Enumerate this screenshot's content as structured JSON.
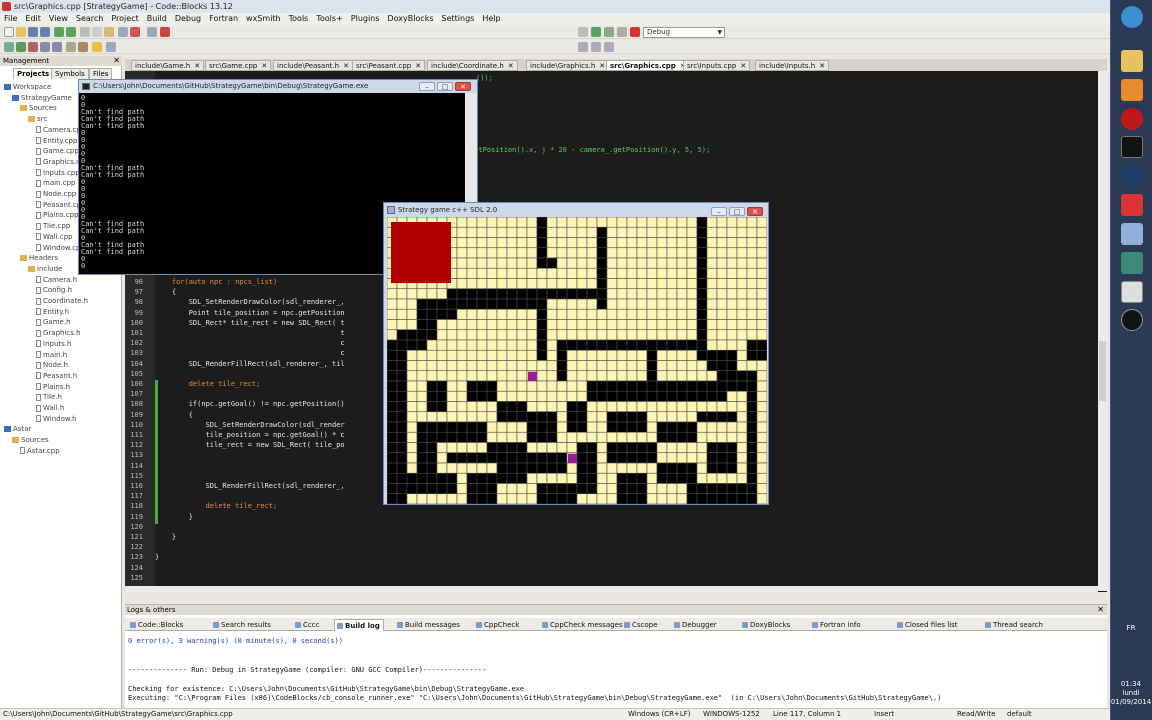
{
  "window_title": "src\\Graphics.cpp [StrategyGame] - Code::Blocks 13.12",
  "menu": [
    "File",
    "Edit",
    "View",
    "Search",
    "Project",
    "Build",
    "Debug",
    "Fortran",
    "wxSmith",
    "Tools",
    "Tools+",
    "Plugins",
    "DoxyBlocks",
    "Settings",
    "Help"
  ],
  "build_target": "Debug",
  "management": {
    "title": "Management",
    "tabs": [
      "Projects",
      "Symbols",
      "Files"
    ],
    "tree": [
      {
        "label": "Workspace",
        "kind": "proj",
        "indent": 0
      },
      {
        "label": "StrategyGame",
        "kind": "proj",
        "indent": 1
      },
      {
        "label": "Sources",
        "kind": "folder",
        "indent": 2
      },
      {
        "label": "src",
        "kind": "folder",
        "indent": 3
      },
      {
        "label": "Camera.cpp",
        "kind": "file",
        "indent": 4
      },
      {
        "label": "Entity.cpp",
        "kind": "file",
        "indent": 4
      },
      {
        "label": "Game.cpp",
        "kind": "file",
        "indent": 4
      },
      {
        "label": "Graphics.cpp",
        "kind": "file",
        "indent": 4
      },
      {
        "label": "Inputs.cpp",
        "kind": "file",
        "indent": 4
      },
      {
        "label": "main.cpp",
        "kind": "file",
        "indent": 4
      },
      {
        "label": "Node.cpp",
        "kind": "file",
        "indent": 4
      },
      {
        "label": "Peasant.cpp",
        "kind": "file",
        "indent": 4
      },
      {
        "label": "Plains.cpp",
        "kind": "file",
        "indent": 4
      },
      {
        "label": "Tile.cpp",
        "kind": "file",
        "indent": 4
      },
      {
        "label": "Wall.cpp",
        "kind": "file",
        "indent": 4
      },
      {
        "label": "Window.cpp",
        "kind": "file",
        "indent": 4
      },
      {
        "label": "Headers",
        "kind": "folder",
        "indent": 2
      },
      {
        "label": "include",
        "kind": "folder",
        "indent": 3
      },
      {
        "label": "Camera.h",
        "kind": "file",
        "indent": 4
      },
      {
        "label": "Config.h",
        "kind": "file",
        "indent": 4
      },
      {
        "label": "Coordinate.h",
        "kind": "file",
        "indent": 4
      },
      {
        "label": "Entity.h",
        "kind": "file",
        "indent": 4
      },
      {
        "label": "Game.h",
        "kind": "file",
        "indent": 4
      },
      {
        "label": "Graphics.h",
        "kind": "file",
        "indent": 4
      },
      {
        "label": "Inputs.h",
        "kind": "file",
        "indent": 4
      },
      {
        "label": "main.h",
        "kind": "file",
        "indent": 4
      },
      {
        "label": "Node.h",
        "kind": "file",
        "indent": 4
      },
      {
        "label": "Peasant.h",
        "kind": "file",
        "indent": 4
      },
      {
        "label": "Plains.h",
        "kind": "file",
        "indent": 4
      },
      {
        "label": "Tile.h",
        "kind": "file",
        "indent": 4
      },
      {
        "label": "Wall.h",
        "kind": "file",
        "indent": 4
      },
      {
        "label": "Window.h",
        "kind": "file",
        "indent": 4
      },
      {
        "label": "Astar",
        "kind": "proj",
        "indent": 0
      },
      {
        "label": "Sources",
        "kind": "folder",
        "indent": 1
      },
      {
        "label": "Astar.cpp",
        "kind": "file",
        "indent": 2
      }
    ]
  },
  "editor_tabs": [
    {
      "label": "include\\Game.h",
      "active": false
    },
    {
      "label": "src\\Game.cpp",
      "active": false
    },
    {
      "label": "include\\Peasant.h",
      "active": false
    },
    {
      "label": "src\\Peasant.cpp",
      "active": false
    },
    {
      "label": "include\\Coordinate.h",
      "active": false
    },
    {
      "label": "include\\Graphics.h",
      "active": false
    },
    {
      "label": "src\\Graphics.cpp",
      "active": true
    },
    {
      "label": "src\\Inputs.cpp",
      "active": false
    },
    {
      "label": "include\\Inputs.h",
      "active": false
    }
  ],
  "code_top_fragments": [
    "());",
    "getPosition().x, j * 20 - camera_.getPosition().y, 5, 5);"
  ],
  "code_lines": [
    {
      "n": "96",
      "t": "    for(auto npc : npcs_list)",
      "kw": true
    },
    {
      "n": "97",
      "t": "    {"
    },
    {
      "n": "98",
      "t": "        SDL_SetRenderDrawColor(sdl_renderer_,"
    },
    {
      "n": "99",
      "t": "        Point tile_position = npc.getPosition"
    },
    {
      "n": "100",
      "t": "        SDL_Rect* tile_rect = new SDL_Rect( t"
    },
    {
      "n": "101",
      "t": "                                            t"
    },
    {
      "n": "102",
      "t": "                                            c"
    },
    {
      "n": "103",
      "t": "                                            c"
    },
    {
      "n": "104",
      "t": "        SDL_RenderFillRect(sdl_renderer_, til"
    },
    {
      "n": "105",
      "t": ""
    },
    {
      "n": "106",
      "t": "        delete tile_rect;",
      "kw": true
    },
    {
      "n": "107",
      "t": ""
    },
    {
      "n": "108",
      "t": "        if(npc.getGoal() != npc.getPosition()"
    },
    {
      "n": "109",
      "t": "        {"
    },
    {
      "n": "110",
      "t": "            SDL_SetRenderDrawColor(sdl_render"
    },
    {
      "n": "111",
      "t": "            tile_position = npc.getGoal() * c"
    },
    {
      "n": "112",
      "t": "            tile_rect = new SDL_Rect( tile_po"
    },
    {
      "n": "113",
      "t": ""
    },
    {
      "n": "114",
      "t": ""
    },
    {
      "n": "115",
      "t": ""
    },
    {
      "n": "116",
      "t": "            SDL_RenderFillRect(sdl_renderer_,"
    },
    {
      "n": "117",
      "t": ""
    },
    {
      "n": "118",
      "t": "            delete tile_rect;",
      "kw": true
    },
    {
      "n": "119",
      "t": "        }"
    },
    {
      "n": "120",
      "t": ""
    },
    {
      "n": "121",
      "t": "    }"
    },
    {
      "n": "122",
      "t": ""
    },
    {
      "n": "123",
      "t": "}"
    },
    {
      "n": "124",
      "t": ""
    },
    {
      "n": "125",
      "t": ""
    }
  ],
  "console": {
    "title": "C:\\Users\\John\\Documents\\GitHub\\StrategyGame\\bin\\Debug\\StrategyGame.exe",
    "lines": [
      "0",
      "0",
      "Can't find path",
      "Can't find path",
      "Can't find path",
      "0",
      "0",
      "0",
      "0",
      "0",
      "Can't find path",
      "Can't find path",
      "0",
      "0",
      "0",
      "0",
      "0",
      "0",
      "Can't find path",
      "Can't find path",
      "0",
      "Can't find path",
      "Can't find path",
      "0",
      "0"
    ]
  },
  "sdl_window": {
    "title": "Strategy game c++ SDL 2.0",
    "colors": {
      "floor": "#fff5b5",
      "wall": "#000000",
      "base": "#b30000",
      "unit": "#9c1a9c",
      "grid": "#4a4a4a"
    }
  },
  "logs": {
    "title": "Logs & others",
    "tabs": [
      {
        "label": "Code::Blocks",
        "active": false
      },
      {
        "label": "Search results",
        "active": false
      },
      {
        "label": "Cccc",
        "active": false
      },
      {
        "label": "Build log",
        "active": true
      },
      {
        "label": "Build messages",
        "active": false
      },
      {
        "label": "CppCheck",
        "active": false
      },
      {
        "label": "CppCheck messages",
        "active": false
      },
      {
        "label": "Cscope",
        "active": false
      },
      {
        "label": "Debugger",
        "active": false
      },
      {
        "label": "DoxyBlocks",
        "active": false
      },
      {
        "label": "Fortran info",
        "active": false
      },
      {
        "label": "Closed files list",
        "active": false
      },
      {
        "label": "Thread search",
        "active": false
      }
    ],
    "lines": [
      "0 error(s), 3 warning(s) (0 minute(s), 0 second(s))",
      "",
      "",
      "-------------- Run: Debug in StrategyGame (compiler: GNU GCC Compiler)---------------",
      "",
      "Checking for existence: C:\\Users\\John\\Documents\\GitHub\\StrategyGame\\bin\\Debug\\StrategyGame.exe",
      "Executing: \"C:\\Program Files (x86)\\CodeBlocks/cb_console_runner.exe\" \"C:\\Users\\John\\Documents\\GitHub\\StrategyGame\\bin\\Debug\\StrategyGame.exe\"  (in C:\\Users\\John\\Documents\\GitHub\\StrategyGame\\.)"
    ]
  },
  "status": {
    "path": "C:\\Users\\John\\Documents\\GitHub\\StrategyGame\\src\\Graphics.cpp",
    "eol": "Windows (CR+LF)",
    "encoding": "WINDOWS-1252",
    "position": "Line 117, Column 1",
    "mode": "Insert",
    "access": "Read/Write",
    "lang": "default"
  },
  "taskbar": {
    "lang": "FR",
    "time": "01:34",
    "day": "lundi",
    "date": "01/09/2014"
  }
}
